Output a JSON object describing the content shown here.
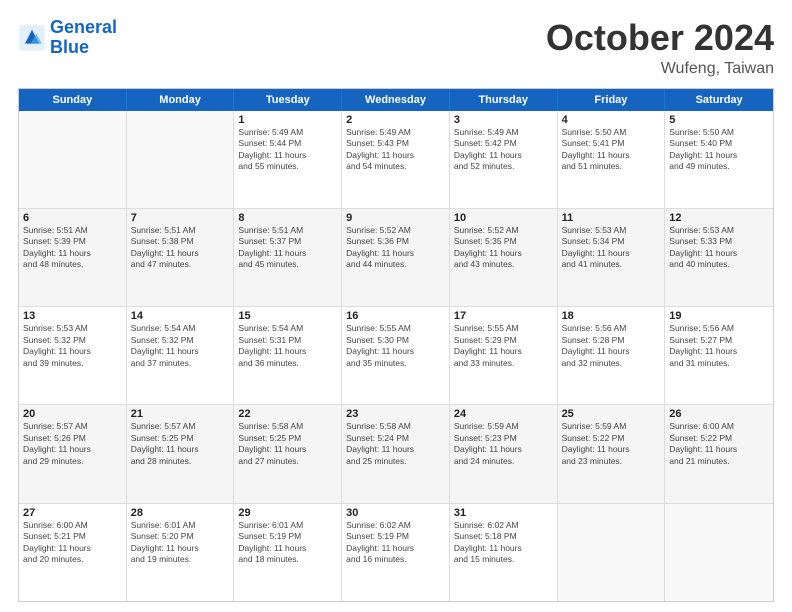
{
  "logo": {
    "line1": "General",
    "line2": "Blue"
  },
  "header": {
    "month": "October 2024",
    "location": "Wufeng, Taiwan"
  },
  "weekdays": [
    "Sunday",
    "Monday",
    "Tuesday",
    "Wednesday",
    "Thursday",
    "Friday",
    "Saturday"
  ],
  "rows": [
    [
      {
        "day": "",
        "detail": ""
      },
      {
        "day": "",
        "detail": ""
      },
      {
        "day": "1",
        "detail": "Sunrise: 5:49 AM\nSunset: 5:44 PM\nDaylight: 11 hours\nand 55 minutes."
      },
      {
        "day": "2",
        "detail": "Sunrise: 5:49 AM\nSunset: 5:43 PM\nDaylight: 11 hours\nand 54 minutes."
      },
      {
        "day": "3",
        "detail": "Sunrise: 5:49 AM\nSunset: 5:42 PM\nDaylight: 11 hours\nand 52 minutes."
      },
      {
        "day": "4",
        "detail": "Sunrise: 5:50 AM\nSunset: 5:41 PM\nDaylight: 11 hours\nand 51 minutes."
      },
      {
        "day": "5",
        "detail": "Sunrise: 5:50 AM\nSunset: 5:40 PM\nDaylight: 11 hours\nand 49 minutes."
      }
    ],
    [
      {
        "day": "6",
        "detail": "Sunrise: 5:51 AM\nSunset: 5:39 PM\nDaylight: 11 hours\nand 48 minutes."
      },
      {
        "day": "7",
        "detail": "Sunrise: 5:51 AM\nSunset: 5:38 PM\nDaylight: 11 hours\nand 47 minutes."
      },
      {
        "day": "8",
        "detail": "Sunrise: 5:51 AM\nSunset: 5:37 PM\nDaylight: 11 hours\nand 45 minutes."
      },
      {
        "day": "9",
        "detail": "Sunrise: 5:52 AM\nSunset: 5:36 PM\nDaylight: 11 hours\nand 44 minutes."
      },
      {
        "day": "10",
        "detail": "Sunrise: 5:52 AM\nSunset: 5:35 PM\nDaylight: 11 hours\nand 43 minutes."
      },
      {
        "day": "11",
        "detail": "Sunrise: 5:53 AM\nSunset: 5:34 PM\nDaylight: 11 hours\nand 41 minutes."
      },
      {
        "day": "12",
        "detail": "Sunrise: 5:53 AM\nSunset: 5:33 PM\nDaylight: 11 hours\nand 40 minutes."
      }
    ],
    [
      {
        "day": "13",
        "detail": "Sunrise: 5:53 AM\nSunset: 5:32 PM\nDaylight: 11 hours\nand 39 minutes."
      },
      {
        "day": "14",
        "detail": "Sunrise: 5:54 AM\nSunset: 5:32 PM\nDaylight: 11 hours\nand 37 minutes."
      },
      {
        "day": "15",
        "detail": "Sunrise: 5:54 AM\nSunset: 5:31 PM\nDaylight: 11 hours\nand 36 minutes."
      },
      {
        "day": "16",
        "detail": "Sunrise: 5:55 AM\nSunset: 5:30 PM\nDaylight: 11 hours\nand 35 minutes."
      },
      {
        "day": "17",
        "detail": "Sunrise: 5:55 AM\nSunset: 5:29 PM\nDaylight: 11 hours\nand 33 minutes."
      },
      {
        "day": "18",
        "detail": "Sunrise: 5:56 AM\nSunset: 5:28 PM\nDaylight: 11 hours\nand 32 minutes."
      },
      {
        "day": "19",
        "detail": "Sunrise: 5:56 AM\nSunset: 5:27 PM\nDaylight: 11 hours\nand 31 minutes."
      }
    ],
    [
      {
        "day": "20",
        "detail": "Sunrise: 5:57 AM\nSunset: 5:26 PM\nDaylight: 11 hours\nand 29 minutes."
      },
      {
        "day": "21",
        "detail": "Sunrise: 5:57 AM\nSunset: 5:25 PM\nDaylight: 11 hours\nand 28 minutes."
      },
      {
        "day": "22",
        "detail": "Sunrise: 5:58 AM\nSunset: 5:25 PM\nDaylight: 11 hours\nand 27 minutes."
      },
      {
        "day": "23",
        "detail": "Sunrise: 5:58 AM\nSunset: 5:24 PM\nDaylight: 11 hours\nand 25 minutes."
      },
      {
        "day": "24",
        "detail": "Sunrise: 5:59 AM\nSunset: 5:23 PM\nDaylight: 11 hours\nand 24 minutes."
      },
      {
        "day": "25",
        "detail": "Sunrise: 5:59 AM\nSunset: 5:22 PM\nDaylight: 11 hours\nand 23 minutes."
      },
      {
        "day": "26",
        "detail": "Sunrise: 6:00 AM\nSunset: 5:22 PM\nDaylight: 11 hours\nand 21 minutes."
      }
    ],
    [
      {
        "day": "27",
        "detail": "Sunrise: 6:00 AM\nSunset: 5:21 PM\nDaylight: 11 hours\nand 20 minutes."
      },
      {
        "day": "28",
        "detail": "Sunrise: 6:01 AM\nSunset: 5:20 PM\nDaylight: 11 hours\nand 19 minutes."
      },
      {
        "day": "29",
        "detail": "Sunrise: 6:01 AM\nSunset: 5:19 PM\nDaylight: 11 hours\nand 18 minutes."
      },
      {
        "day": "30",
        "detail": "Sunrise: 6:02 AM\nSunset: 5:19 PM\nDaylight: 11 hours\nand 16 minutes."
      },
      {
        "day": "31",
        "detail": "Sunrise: 6:02 AM\nSunset: 5:18 PM\nDaylight: 11 hours\nand 15 minutes."
      },
      {
        "day": "",
        "detail": ""
      },
      {
        "day": "",
        "detail": ""
      }
    ]
  ]
}
